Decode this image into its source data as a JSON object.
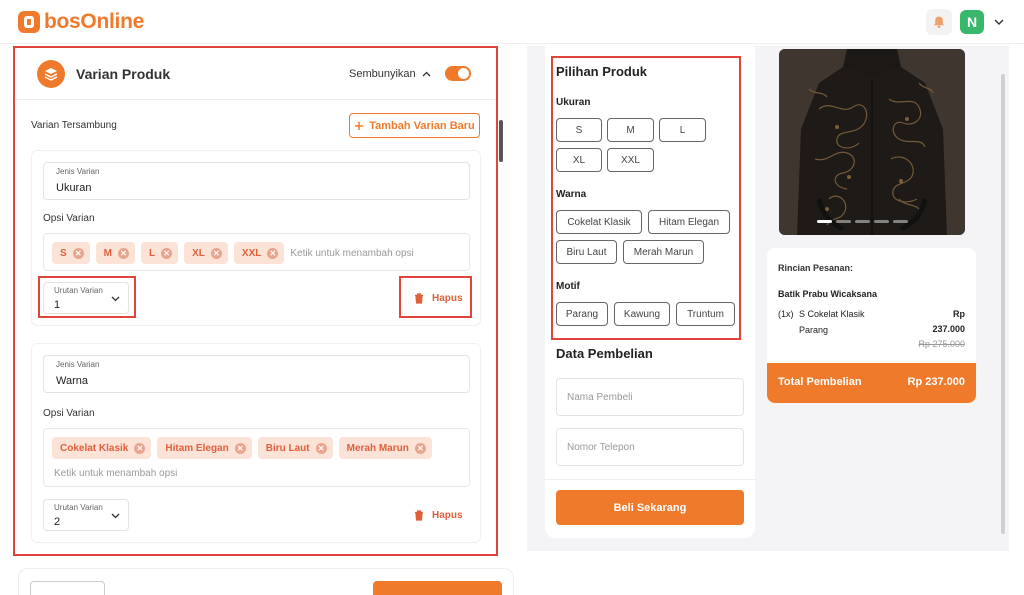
{
  "header": {
    "brand": "bosOnline",
    "avatar_initial": "N"
  },
  "panel": {
    "title": "Varian Produk",
    "hide_label": "Sembunyikan",
    "section_label": "Varian Tersambung",
    "add_button": "Tambah Varian Baru",
    "variants": [
      {
        "type_label": "Jenis Varian",
        "type_value": "Ukuran",
        "options_label": "Opsi Varian",
        "options": [
          "S",
          "M",
          "L",
          "XL",
          "XXL"
        ],
        "options_placeholder": "Ketik untuk menambah opsi",
        "order_label": "Urutan Varian",
        "order_value": "1",
        "delete_label": "Hapus"
      },
      {
        "type_label": "Jenis Varian",
        "type_value": "Warna",
        "options_label": "Opsi Varian",
        "options": [
          "Cokelat Klasik",
          "Hitam Elegan",
          "Biru Laut",
          "Merah Marun"
        ],
        "options_placeholder": "Ketik untuk menambah opsi",
        "order_label": "Urutan Varian",
        "order_value": "2",
        "delete_label": "Hapus"
      }
    ]
  },
  "preview": {
    "title": "Pilihan Produk",
    "groups": [
      {
        "label": "Ukuran",
        "options": [
          "S",
          "M",
          "L",
          "XL",
          "XXL"
        ]
      },
      {
        "label": "Warna",
        "options": [
          "Cokelat Klasik",
          "Hitam Elegan",
          "Biru Laut",
          "Merah Marun"
        ]
      },
      {
        "label": "Motif",
        "options": [
          "Parang",
          "Kawung",
          "Truntum"
        ]
      }
    ],
    "purchase_title": "Data Pembelian",
    "buyer_placeholder": "Nama Pembeli",
    "phone_placeholder": "Nomor Telepon",
    "buy_button": "Beli Sekarang"
  },
  "summary": {
    "label": "Rincian Pesanan:",
    "product": "Batik Prabu Wicaksana",
    "qty": "(1x)",
    "variant_line1": "S Cokelat Klasik",
    "variant_line2": "Parang",
    "currency": "Rp",
    "price": "237.000",
    "old_price": "Rp 275.000",
    "total_label": "Total Pembelian",
    "total_value": "Rp 237.000"
  },
  "colors": {
    "accent": "#f07a2c",
    "highlight": "#e0453a",
    "chip_bg": "#fbe3d8",
    "success": "#39b76a"
  }
}
